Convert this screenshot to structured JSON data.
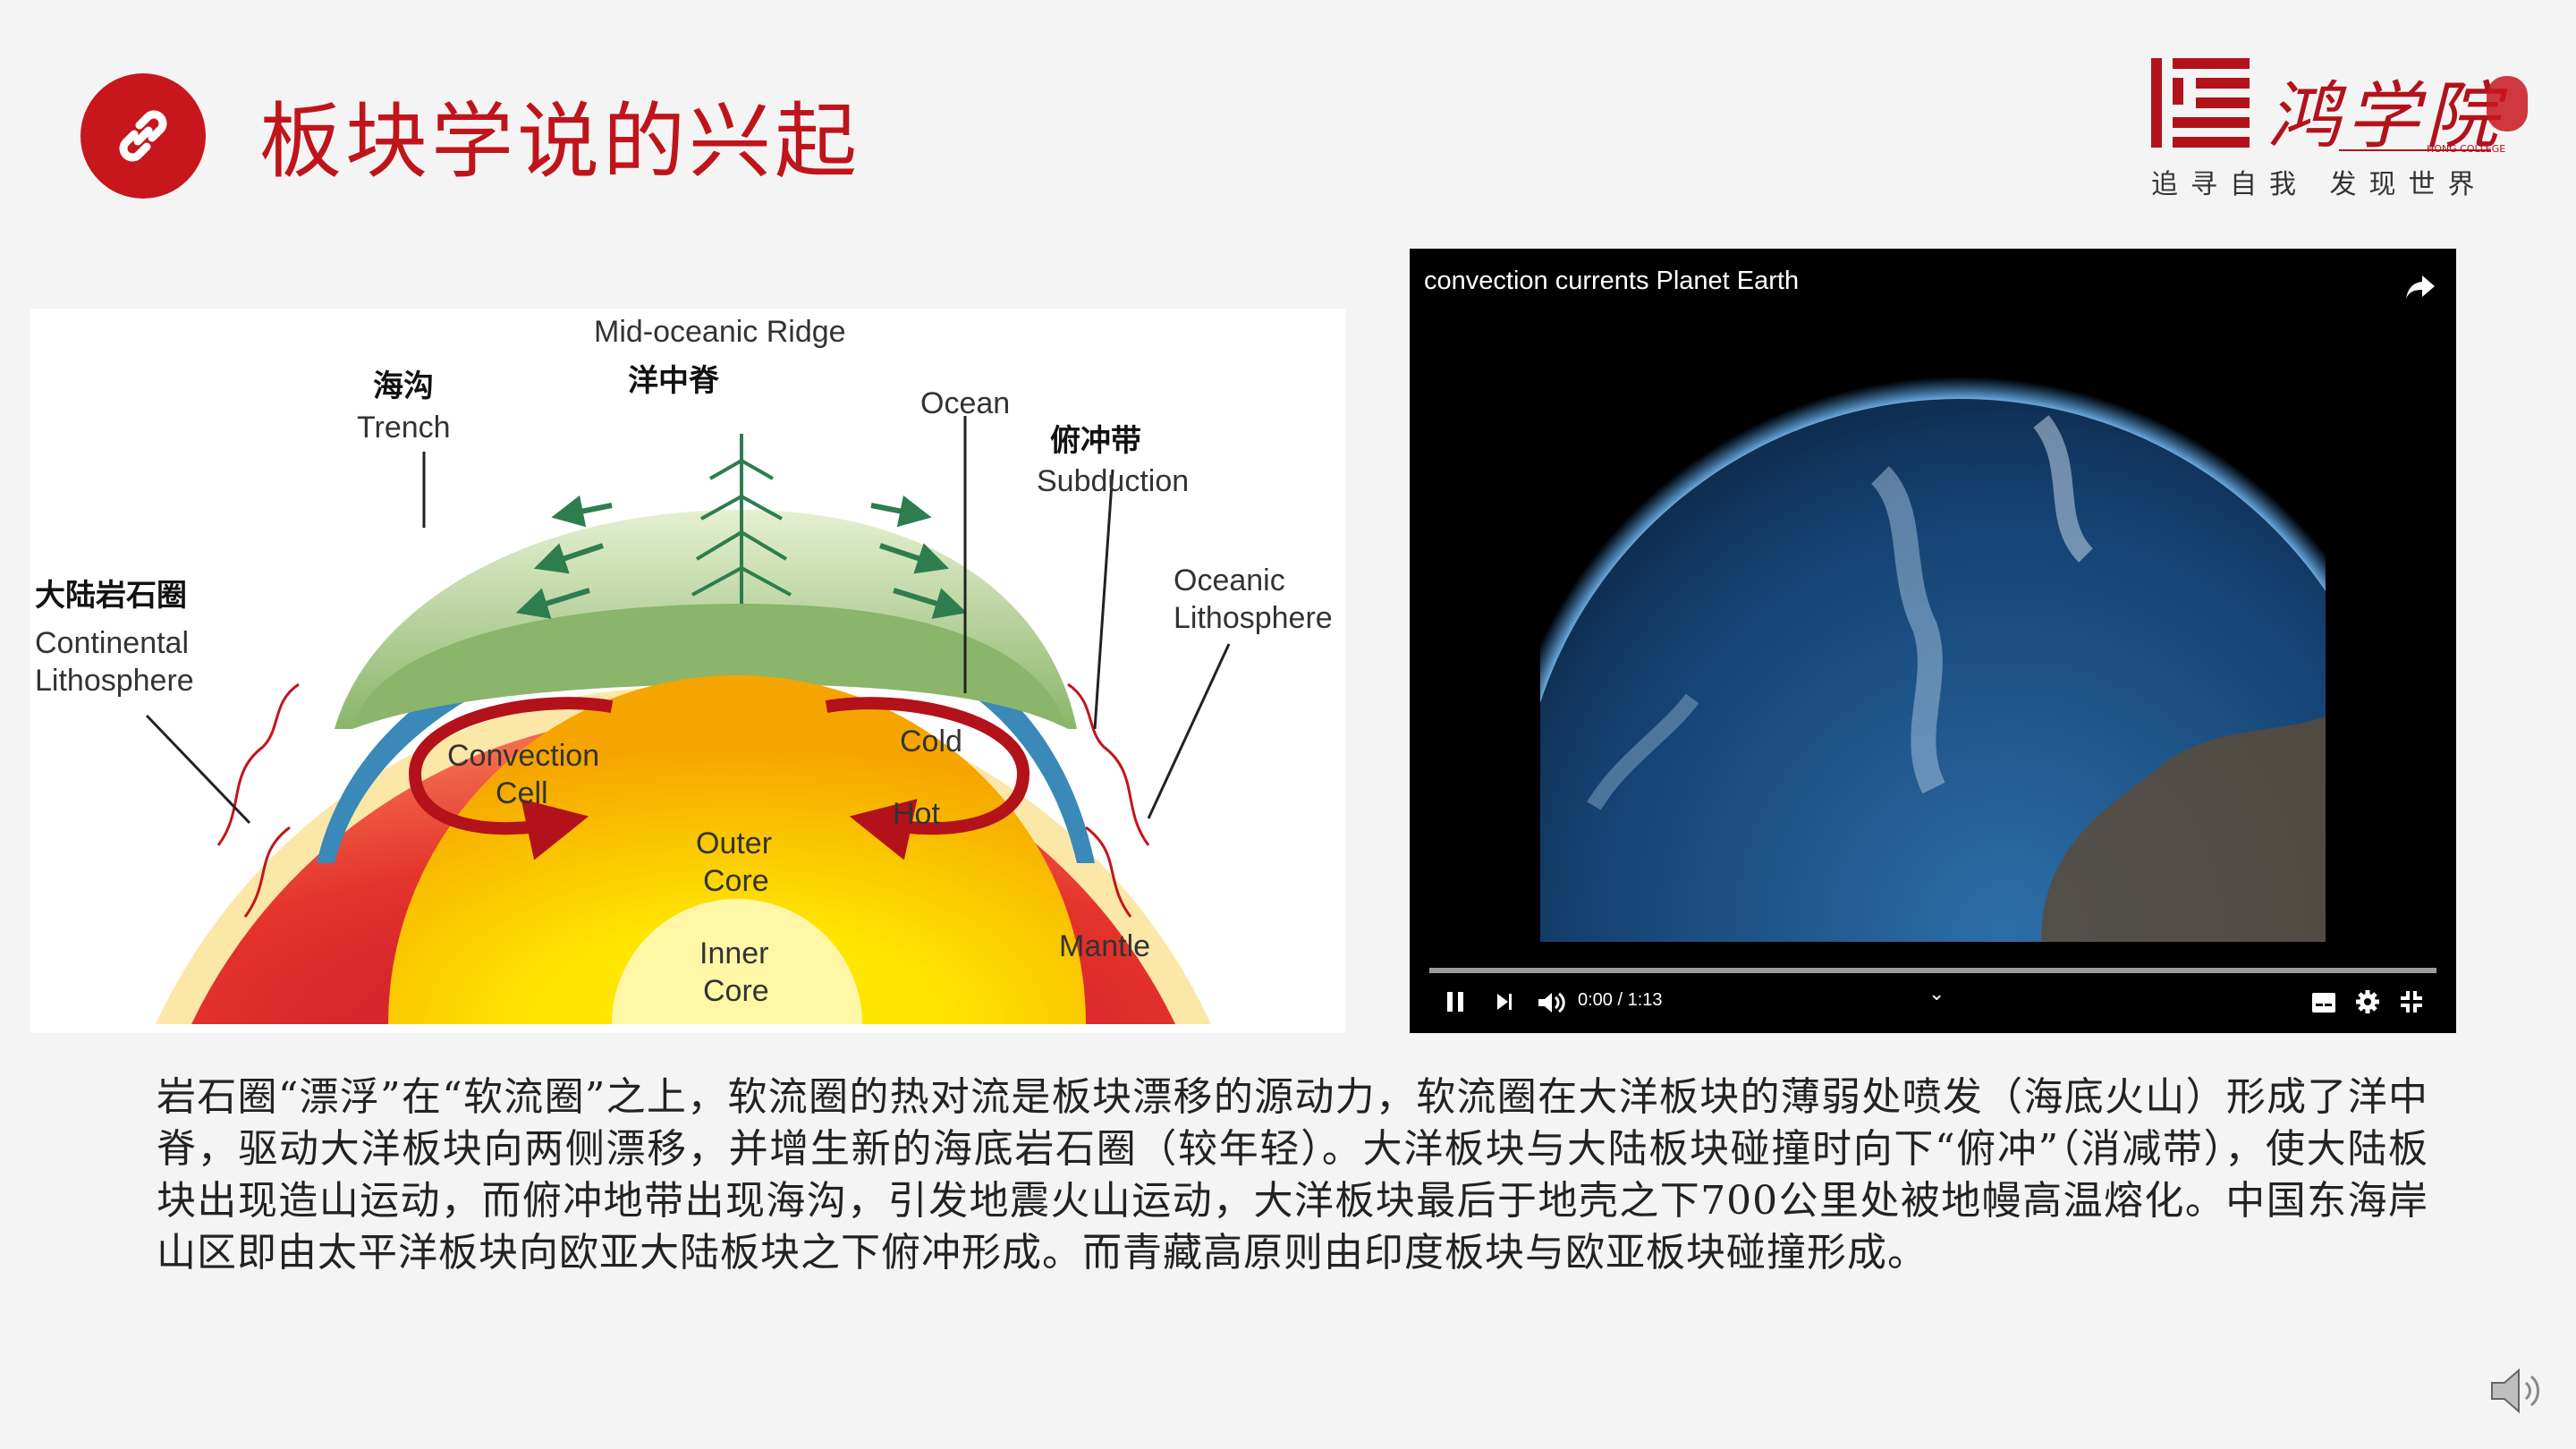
{
  "slide": {
    "title": "板块学说的兴起",
    "title_icon": "link-icon",
    "accent_color": "#c8161d"
  },
  "logo": {
    "brand": "鸿学院",
    "english": "HONG COLLEGE",
    "slogan": "追寻自我 发现世界"
  },
  "diagram": {
    "mid_ridge_en": "Mid-oceanic Ridge",
    "mid_ridge_cn": "洋中脊",
    "trench_cn": "海沟",
    "trench_en": "Trench",
    "ocean": "Ocean",
    "subduction_cn": "俯冲带",
    "subduction_en": "Subduction",
    "oceanic_litho_1": "Oceanic",
    "oceanic_litho_2": "Lithosphere",
    "continental_cn": "大陆岩石圈",
    "continental_1": "Continental",
    "continental_2": "Lithosphere",
    "convection_1": "Convection",
    "convection_2": "Cell",
    "cold": "Cold",
    "hot": "Hot",
    "outer_core_1": "Outer",
    "outer_core_2": "Core",
    "inner_core_1": "Inner",
    "inner_core_2": "Core",
    "mantle": "Mantle"
  },
  "video": {
    "title": "convection currents Planet Earth",
    "time": "0:00 / 1:13",
    "progress": 0,
    "icons": [
      "share-icon",
      "play-icon",
      "next-icon",
      "volume-icon",
      "chevron-down-icon",
      "subtitles-icon",
      "settings-icon",
      "exit-fullscreen-icon"
    ]
  },
  "body": {
    "paragraph": "岩石圈“漂浮”在“软流圈”之上，软流圈的热对流是板块漂移的源动力，软流圈在大洋板块的薄弱处喷发（海底火山）形成了洋中脊，驱动大洋板块向两侧漂移，并增生新的海底岩石圈（较年轻）。大洋板块与大陆板块碰撞时向下“俯冲”（消减带），使大陆板块出现造山运动，而俯冲地带出现海沟，引发地震火山运动，大洋板块最后于地壳之下700公里处被地幔高温熔化。中国东海岸山区即由太平洋板块向欧亚大陆板块之下俯冲形成。而青藏高原则由印度板块与欧亚板块碰撞形成。"
  },
  "audio": {
    "icon": "speaker-icon"
  }
}
